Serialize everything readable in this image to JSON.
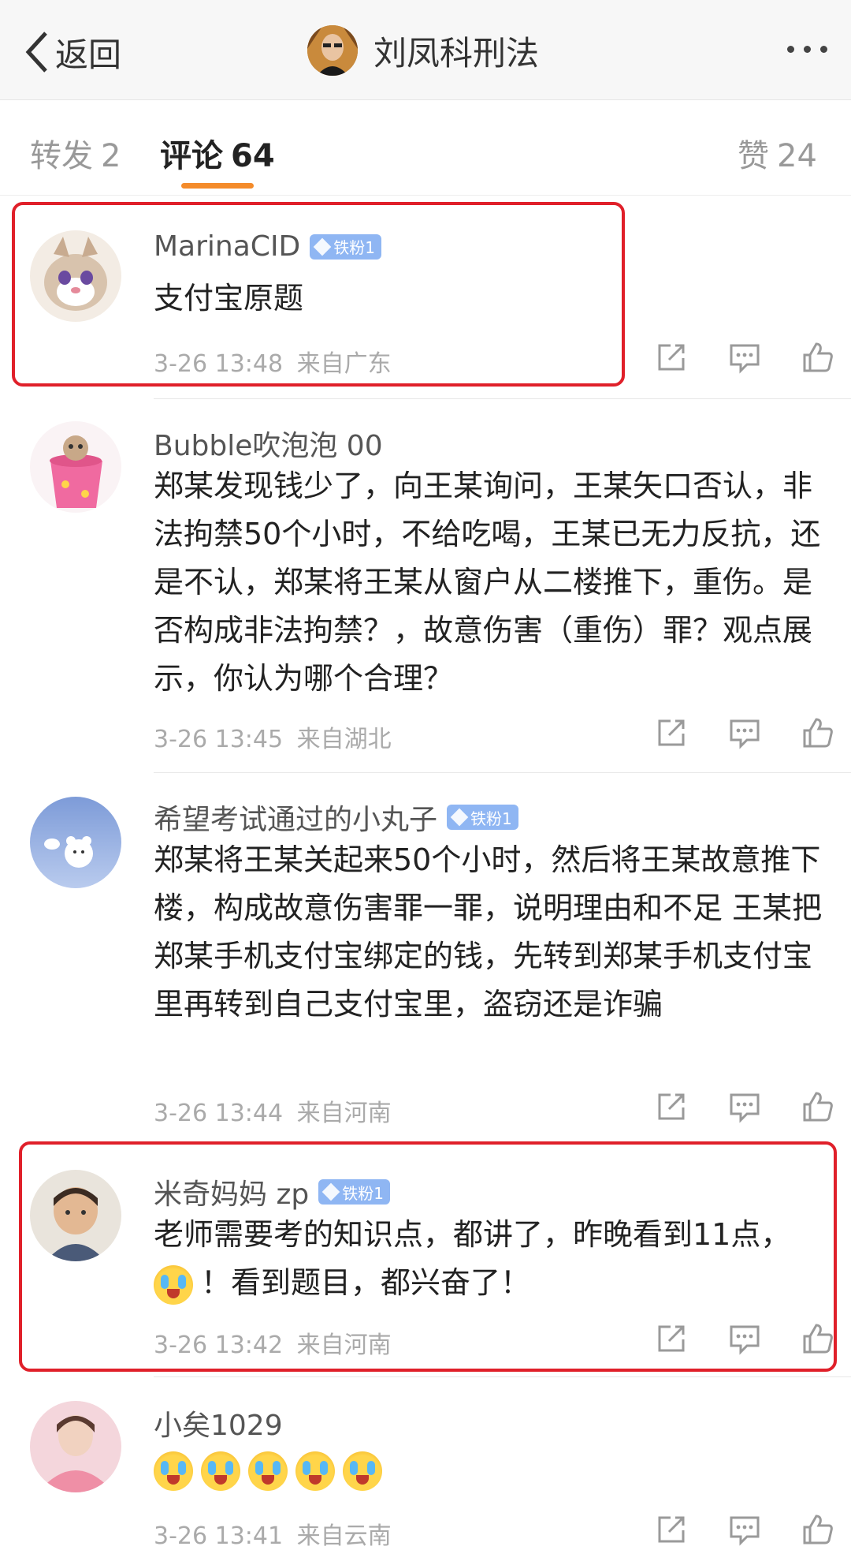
{
  "nav": {
    "back_label": "返回",
    "title": "刘凤科刑法"
  },
  "tabs": {
    "repost": {
      "label": "转发",
      "count": "2"
    },
    "comment": {
      "label": "评论",
      "count": "64"
    },
    "like": {
      "label": "赞",
      "count": "24"
    }
  },
  "comments": [
    {
      "user": "MarinaCID",
      "badge": "铁粉1",
      "text": "支付宝原题",
      "time": "3-26 13:48",
      "location": "来自广东"
    },
    {
      "user": "Bubble吹泡泡 00",
      "badge": "",
      "text": "郑某发现钱少了，向王某询问，王某矢口否认，非法拘禁50个小时，不给吃喝，王某已无力反抗，还是不认，郑某将王某从窗户从二楼推下，重伤。是否构成非法拘禁？，故意伤害（重伤）罪？观点展示，你认为哪个合理？",
      "time": "3-26 13:45",
      "location": "来自湖北"
    },
    {
      "user": "希望考试通过的小丸子",
      "badge": "铁粉1",
      "text": "郑某将王某关起来50个小时，然后将王某故意推下楼，构成故意伤害罪一罪，说明理由和不足 王某把郑某手机支付宝绑定的钱，先转到郑某手机支付宝里再转到自己支付宝里，盗窃还是诈骗",
      "time": "3-26 13:44",
      "location": "来自河南"
    },
    {
      "user": "米奇妈妈 zp",
      "badge": "铁粉1",
      "text_a": "老师需要考的知识点，都讲了，昨晚看到11点，",
      "text_b": "！看到题目，都兴奋了！",
      "time": "3-26 13:42",
      "location": "来自河南"
    },
    {
      "user": "小矣1029",
      "badge": "",
      "emoji_count": 5,
      "time": "3-26 13:41",
      "location": "来自云南"
    }
  ],
  "icons": {
    "share": "share-icon",
    "reply": "comment-icon",
    "like": "thumbs-up-icon"
  },
  "colors": {
    "accent": "#f48b2a",
    "highlight": "#e0202a",
    "badge": "#8fb6f3"
  }
}
